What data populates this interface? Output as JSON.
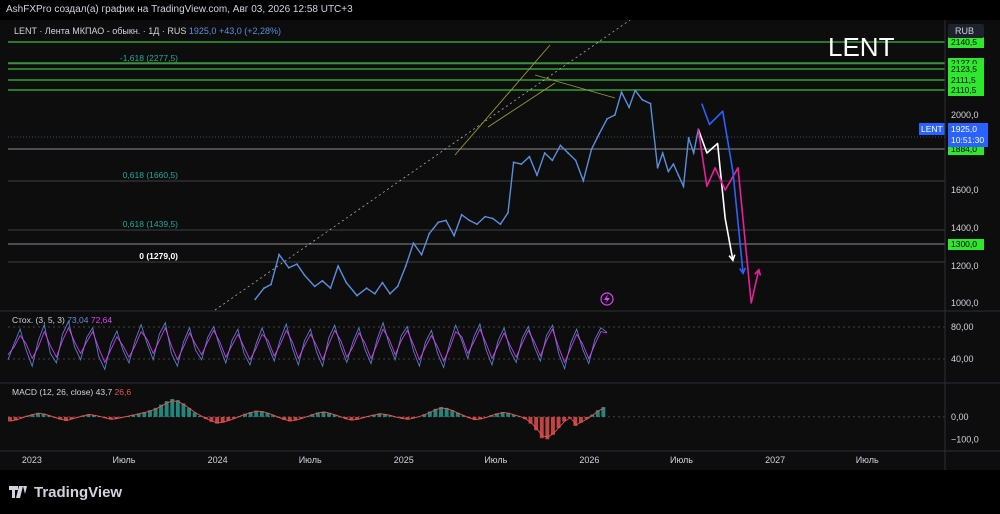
{
  "header": {
    "text": "AshFXPro создал(а) график на TradingView.com, Авг 03, 2026 12:58 UTC+3"
  },
  "footer": {
    "brand": "TradingView"
  },
  "watermark": {
    "ticker": "LENT"
  },
  "legend": {
    "symbol": "LENT · Лента МКПАО - обыкн. · 1Д · RUS",
    "price": "1925,0",
    "change": "+43,0 (+2,28%)"
  },
  "currency": "RUB",
  "price_tag": {
    "symbol": "LENT",
    "price": "1925,0",
    "countdown": "10:51:30"
  },
  "colors": {
    "price_line": "#5b8fdc",
    "stoch_k": "#5b8fdc",
    "stoch_d": "#e040fb",
    "macd_up": "#26a69a",
    "macd_down": "#ef5350",
    "green_label": "#2ee82e",
    "projection_blue": "#2962ff",
    "projection_pink": "#e91e9b",
    "projection_white": "#ffffff"
  },
  "chart_data": [
    {
      "type": "line",
      "title": "",
      "x_ticks": [
        "2023",
        "Июль",
        "2024",
        "Июль",
        "2025",
        "Июль",
        "2026",
        "Июль",
        "2027",
        "Июль"
      ],
      "y_ticks": [
        "1000,0",
        "1200,0",
        "1400,0",
        "1600,0",
        "2000,0"
      ],
      "green_levels": [
        {
          "value": 2140.5,
          "label": "2140,5"
        },
        {
          "value": 2127.0,
          "label": "2127,0"
        },
        {
          "value": 2123.5,
          "label": "2123,5"
        },
        {
          "value": 2111.5,
          "label": "2111,5"
        },
        {
          "value": 2110.5,
          "label": "2110,5"
        },
        {
          "value": 1884.0,
          "label": "1884,0"
        },
        {
          "value": 1300.0,
          "label": "1300,0"
        }
      ],
      "fib_levels": [
        {
          "value": 2277.5,
          "label": "-1,618 (2277,5)"
        },
        {
          "value": 1660.5,
          "label": "0,618 (1660,5)"
        },
        {
          "value": 1439.5,
          "label": "0,618 (1439,5)"
        },
        {
          "value": 1279.0,
          "label": "0 (1279,0)"
        }
      ],
      "series": [
        {
          "x": [
            "2024-03-15",
            "2024-04-01",
            "2024-04-15",
            "2024-05-01",
            "2024-05-20",
            "2024-06-05",
            "2024-06-20",
            "2024-07-10",
            "2024-07-25",
            "2024-08-10",
            "2024-08-25",
            "2024-09-10",
            "2024-10-01",
            "2024-10-20",
            "2024-11-05",
            "2024-11-20",
            "2024-12-05",
            "2024-12-20",
            "2025-01-05",
            "2025-01-20",
            "2025-02-05",
            "2025-02-20",
            "2025-03-10",
            "2025-03-25",
            "2025-04-10",
            "2025-04-25",
            "2025-05-10",
            "2025-05-25",
            "2025-06-10",
            "2025-06-25",
            "2025-07-10",
            "2025-07-25",
            "2025-08-05",
            "2025-08-20",
            "2025-09-05",
            "2025-09-20",
            "2025-10-05",
            "2025-10-20",
            "2025-11-05",
            "2025-11-20",
            "2025-12-05",
            "2025-12-20",
            "2026-01-05",
            "2026-01-20",
            "2026-02-05",
            "2026-02-20",
            "2026-03-05",
            "2026-03-20",
            "2026-04-01",
            "2026-04-15",
            "2026-05-01",
            "2026-05-15",
            "2026-05-25",
            "2026-06-05",
            "2026-06-15",
            "2026-06-25",
            "2026-07-05",
            "2026-07-15",
            "2026-07-25",
            "2026-08-03"
          ],
          "values": [
            1020,
            1080,
            1100,
            1260,
            1190,
            1210,
            1150,
            1090,
            1120,
            1080,
            1200,
            1110,
            1040,
            1080,
            1050,
            1110,
            1050,
            1090,
            1200,
            1320,
            1260,
            1370,
            1430,
            1440,
            1360,
            1470,
            1440,
            1420,
            1460,
            1450,
            1420,
            1480,
            1750,
            1740,
            1780,
            1680,
            1800,
            1760,
            1840,
            1800,
            1760,
            1650,
            1820,
            1900,
            1980,
            2000,
            2120,
            2040,
            2130,
            2080,
            2060,
            1720,
            1800,
            1700,
            1740,
            1680,
            1620,
            1880,
            1800,
            1925
          ]
        }
      ],
      "annotations": [
        {
          "color": "white",
          "x": [
            "2026-08-03",
            "2026-08-20",
            "2026-09-10",
            "2026-09-25",
            "2026-10-10"
          ],
          "values": [
            1925,
            1800,
            1850,
            1450,
            1230
          ]
        },
        {
          "color": "pink",
          "x": [
            "2026-08-03",
            "2026-08-20",
            "2026-09-05",
            "2026-09-25",
            "2026-10-20",
            "2026-11-15",
            "2026-11-30"
          ],
          "values": [
            1925,
            1620,
            1720,
            1600,
            1720,
            1000,
            1180
          ]
        },
        {
          "color": "blue",
          "x": [
            "2026-08-10",
            "2026-08-25",
            "2026-09-20",
            "2026-10-10",
            "2026-10-30"
          ],
          "values": [
            2060,
            1950,
            2020,
            1700,
            1160
          ]
        }
      ]
    },
    {
      "type": "line",
      "title": "Стох. (3, 5, 3)",
      "legend_values": [
        "73,04",
        "72,64"
      ],
      "y_ticks": [
        "80,00",
        "40,00"
      ],
      "ylim": [
        0,
        100
      ],
      "series": [
        {
          "name": "",
          "values": [
            30,
            55,
            78,
            45,
            20,
            60,
            85,
            40,
            25,
            70,
            90,
            50,
            30,
            65,
            80,
            35,
            15,
            55,
            75,
            45,
            25,
            60,
            85,
            55,
            30,
            70,
            88,
            40,
            20,
            58,
            80,
            45,
            30,
            65,
            82,
            50,
            25,
            60,
            78,
            40,
            22,
            55,
            80,
            52,
            28,
            62,
            86,
            48,
            22,
            60,
            78,
            42,
            20,
            64,
            84,
            50,
            26,
            58,
            80,
            46,
            24,
            62,
            88,
            54,
            30,
            68,
            82,
            44,
            20,
            58,
            76,
            40,
            18,
            56,
            84,
            60,
            32,
            66,
            86,
            46,
            22,
            60,
            80,
            44,
            26,
            64,
            82,
            50,
            28,
            68,
            84,
            40,
            16,
            56,
            78,
            46,
            24,
            62,
            80,
            73
          ]
        },
        {
          "name": "",
          "values": [
            38,
            50,
            68,
            55,
            32,
            50,
            74,
            52,
            34,
            60,
            80,
            58,
            40,
            58,
            74,
            48,
            26,
            46,
            66,
            52,
            34,
            52,
            74,
            62,
            40,
            60,
            80,
            52,
            30,
            50,
            72,
            54,
            38,
            58,
            76,
            58,
            34,
            52,
            70,
            50,
            30,
            48,
            70,
            60,
            36,
            54,
            76,
            58,
            32,
            52,
            70,
            52,
            30,
            54,
            76,
            60,
            34,
            50,
            72,
            56,
            32,
            54,
            78,
            62,
            38,
            60,
            76,
            54,
            30,
            50,
            68,
            50,
            28,
            48,
            74,
            66,
            40,
            58,
            78,
            56,
            32,
            52,
            72,
            52,
            34,
            56,
            76,
            58,
            36,
            60,
            78,
            50,
            26,
            48,
            70,
            54,
            32,
            54,
            74,
            72
          ]
        }
      ]
    },
    {
      "type": "bar",
      "title": "MACD (12, 26, close)",
      "legend_values": [
        "43,7",
        "26,6"
      ],
      "y_ticks": [
        "0,00",
        "−100,0"
      ],
      "ylim": [
        -130,
        120
      ],
      "values": [
        -20,
        -15,
        -5,
        5,
        12,
        18,
        14,
        6,
        -4,
        -12,
        -18,
        -10,
        -2,
        6,
        12,
        8,
        2,
        -6,
        -12,
        -8,
        -2,
        4,
        10,
        16,
        22,
        30,
        40,
        55,
        70,
        80,
        75,
        60,
        40,
        20,
        5,
        -10,
        -22,
        -30,
        -26,
        -18,
        -8,
        4,
        14,
        22,
        28,
        26,
        18,
        8,
        -4,
        -14,
        -20,
        -16,
        -8,
        2,
        12,
        20,
        24,
        18,
        10,
        0,
        -10,
        -16,
        -12,
        -4,
        4,
        10,
        16,
        12,
        6,
        -2,
        -8,
        -12,
        -6,
        2,
        12,
        24,
        36,
        44,
        40,
        30,
        18,
        6,
        -6,
        -14,
        -10,
        -2,
        8,
        16,
        22,
        18,
        10,
        2,
        -10,
        -30,
        -60,
        -95,
        -100,
        -80,
        -50,
        -20,
        -5,
        -40,
        -25,
        -10,
        10,
        30,
        44
      ]
    }
  ]
}
